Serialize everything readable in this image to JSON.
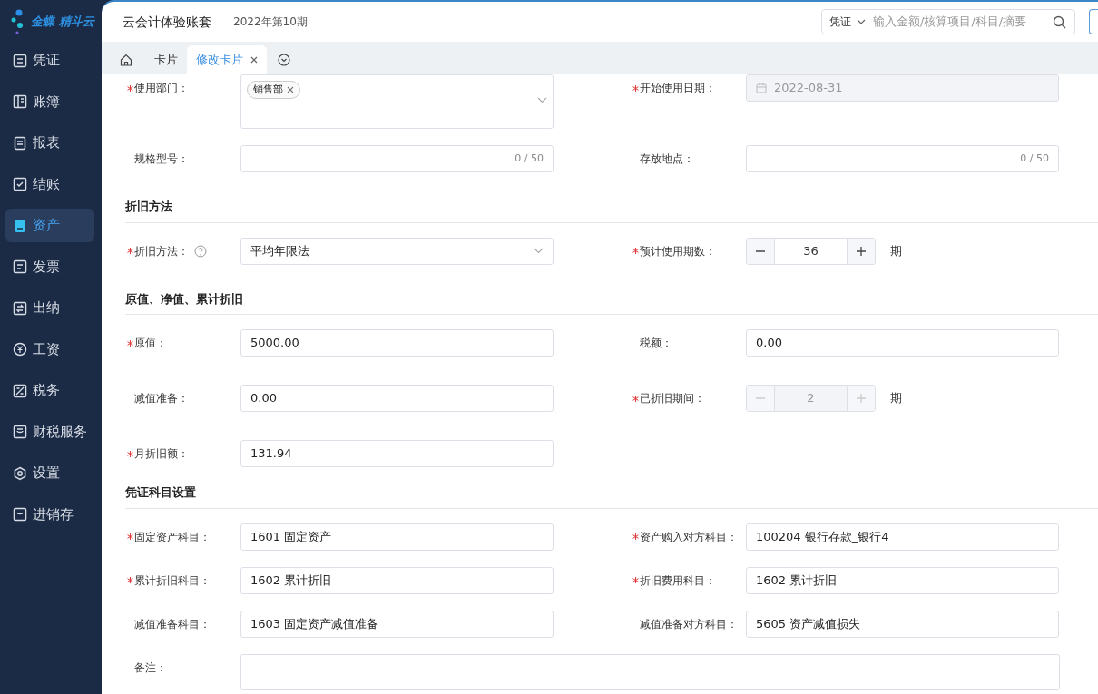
{
  "sidebar": {
    "logo": "金蝶 精斗云",
    "items": [
      {
        "label": "凭证",
        "selected": false
      },
      {
        "label": "账簿",
        "selected": false
      },
      {
        "label": "报表",
        "selected": false
      },
      {
        "label": "结账",
        "selected": false
      },
      {
        "label": "资产",
        "selected": true
      },
      {
        "label": "发票",
        "selected": false
      },
      {
        "label": "出纳",
        "selected": false
      },
      {
        "label": "工资",
        "selected": false
      },
      {
        "label": "税务",
        "selected": false
      },
      {
        "label": "财税服务",
        "selected": false
      },
      {
        "label": "设置",
        "selected": false
      },
      {
        "label": "进销存",
        "selected": false
      }
    ]
  },
  "header": {
    "title": "云会计体验账套",
    "period": "2022年第10期",
    "search": {
      "scope": "凭证",
      "placeholder": "输入金额/核算项目/科目/摘要"
    }
  },
  "tabs": [
    {
      "label": "卡片",
      "selected": false,
      "closable": false
    },
    {
      "label": "修改卡片",
      "selected": true,
      "closable": true
    }
  ],
  "sections": [
    {
      "rows": [
        [
          {
            "kind": "tags",
            "label": "使用部门：",
            "required": true,
            "disabled": false,
            "tags": [
              "销售部"
            ]
          },
          {
            "kind": "date",
            "label": "开始使用日期：",
            "required": true,
            "disabled": true,
            "value": "2022-08-31"
          }
        ],
        [
          {
            "kind": "counter",
            "label": "规格型号：",
            "required": false,
            "disabled": false,
            "counter": "0 / 50"
          },
          {
            "kind": "counter",
            "label": "存放地点：",
            "required": false,
            "disabled": false,
            "counter": "0 / 50"
          }
        ]
      ]
    },
    {
      "title": "折旧方法",
      "rows": [
        [
          {
            "kind": "select",
            "label": "折旧方法：",
            "required": true,
            "disabled": false,
            "help": true,
            "value": "平均年限法"
          },
          {
            "kind": "stepper",
            "label": "预计使用期数：",
            "required": true,
            "disabled": false,
            "value": "36",
            "unit": "期"
          }
        ]
      ]
    },
    {
      "title": "原值、净值、累计折旧",
      "rows": [
        [
          {
            "kind": "text",
            "label": "原值：",
            "required": true,
            "disabled": false,
            "value": "5000.00"
          },
          {
            "kind": "text",
            "label": "税额：",
            "required": false,
            "disabled": false,
            "value": "0.00"
          }
        ],
        [
          {
            "kind": "text",
            "label": "减值准备：",
            "required": false,
            "disabled": false,
            "value": "0.00"
          },
          {
            "kind": "stepper",
            "label": "已折旧期间：",
            "required": true,
            "disabled": true,
            "value": "2",
            "unit": "期"
          }
        ],
        [
          {
            "kind": "text",
            "label": "月折旧额：",
            "required": true,
            "disabled": false,
            "value": "131.94"
          }
        ]
      ]
    },
    {
      "title": "凭证科目设置",
      "rows": [
        [
          {
            "kind": "text",
            "label": "固定资产科目：",
            "required": true,
            "disabled": false,
            "value": "1601 固定资产"
          },
          {
            "kind": "text",
            "label": "资产购入对方科目：",
            "required": true,
            "disabled": false,
            "value": "100204 银行存款_银行4"
          }
        ],
        [
          {
            "kind": "text",
            "label": "累计折旧科目：",
            "required": true,
            "disabled": false,
            "value": "1602 累计折旧"
          },
          {
            "kind": "text",
            "label": "折旧费用科目：",
            "required": true,
            "disabled": false,
            "value": "1602 累计折旧"
          }
        ],
        [
          {
            "kind": "text",
            "label": "减值准备科目：",
            "required": false,
            "disabled": false,
            "value": "1603 固定资产减值准备"
          },
          {
            "kind": "text",
            "label": "减值准备对方科目：",
            "required": false,
            "disabled": false,
            "value": "5605 资产减值损失"
          }
        ],
        [
          {
            "kind": "textarea",
            "label": "备注：",
            "required": false,
            "disabled": false
          }
        ]
      ]
    }
  ]
}
